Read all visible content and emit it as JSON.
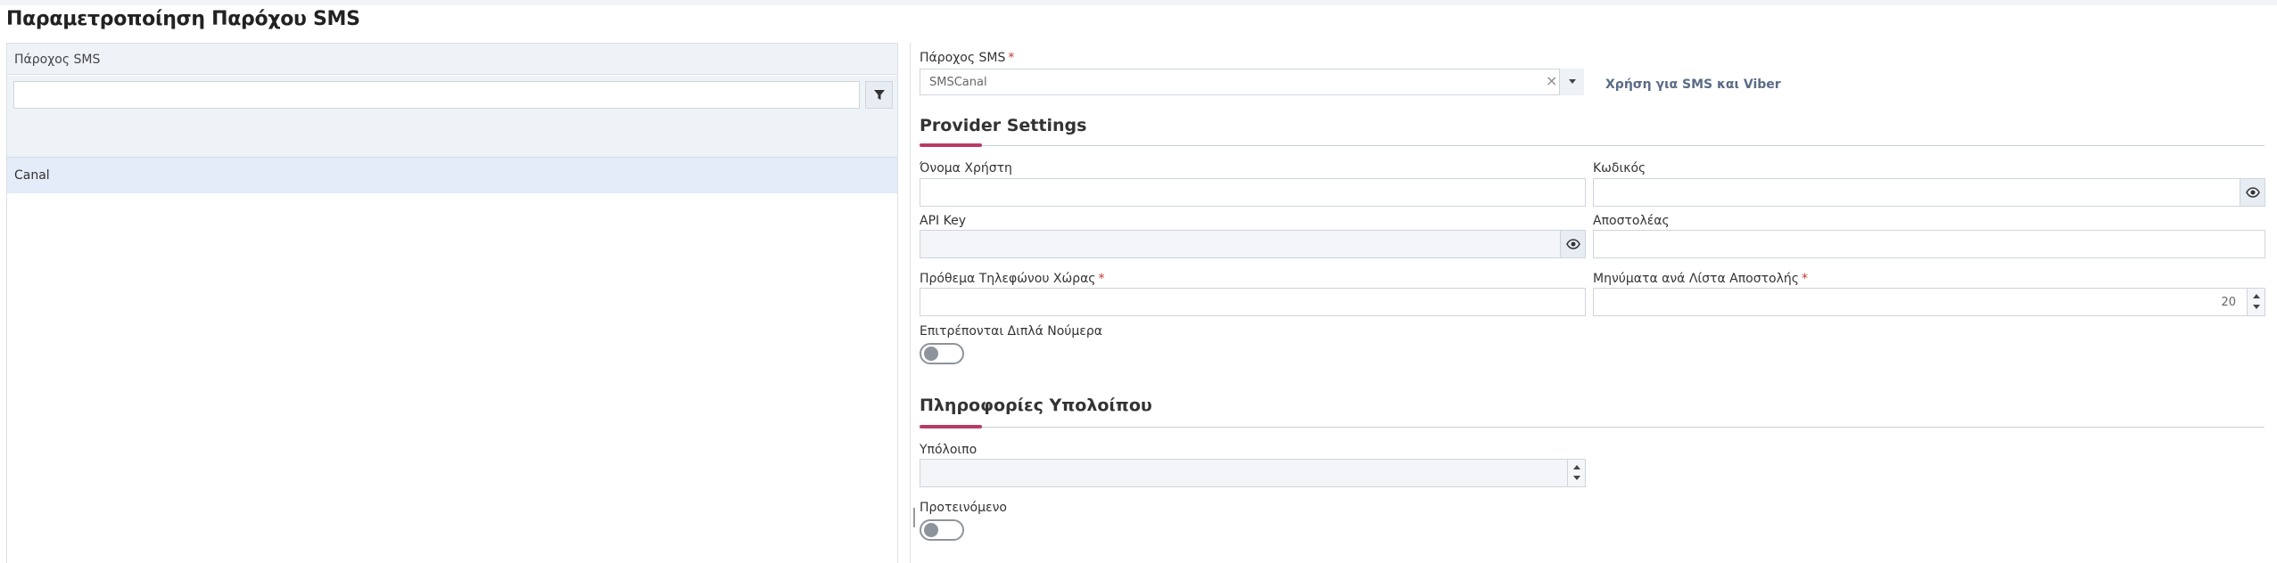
{
  "page": {
    "title": "Παραμετροποίηση Παρόχου SMS"
  },
  "list_panel": {
    "column_header": "Πάροχος SMS",
    "filter_value": "",
    "rows": [
      "Canal"
    ]
  },
  "form": {
    "provider": {
      "label": "Πάροχος SMS",
      "required_mark": "*",
      "value": "SMSCanal",
      "clear_icon": "×",
      "hint": "Χρήση για SMS και Viber"
    },
    "provider_settings": {
      "title": "Provider Settings",
      "username": {
        "label": "Όνομα Χρήστη",
        "value": ""
      },
      "password": {
        "label": "Κωδικός",
        "value": ""
      },
      "api_key": {
        "label": "API Key",
        "value": ""
      },
      "sender": {
        "label": "Αποστολέας",
        "value": ""
      },
      "country_prefix": {
        "label": "Πρόθεμα Τηλεφώνου Χώρας",
        "required_mark": "*",
        "value": ""
      },
      "messages_per_list": {
        "label": "Μηνύματα ανά Λίστα Αποστολής",
        "required_mark": "*",
        "value": "20"
      },
      "allow_duplicates": {
        "label": "Επιτρέπονται Διπλά Νούμερα",
        "checked": false
      }
    },
    "balance_info": {
      "title": "Πληροφορίες Υπολοίπου",
      "balance": {
        "label": "Υπόλοιπο",
        "value": ""
      },
      "default": {
        "label": "Προτεινόμενο",
        "checked": false
      }
    }
  },
  "colors": {
    "accent": "#b93a66",
    "header_bg": "#eef3f8",
    "selected_row_bg": "#e3ecf8",
    "link": "#5a6b86",
    "required": "#c0392b"
  },
  "icons": {
    "filter": "filter-icon",
    "eye": "eye-icon",
    "chevron": "chevron-down-icon",
    "clear": "close-icon"
  }
}
